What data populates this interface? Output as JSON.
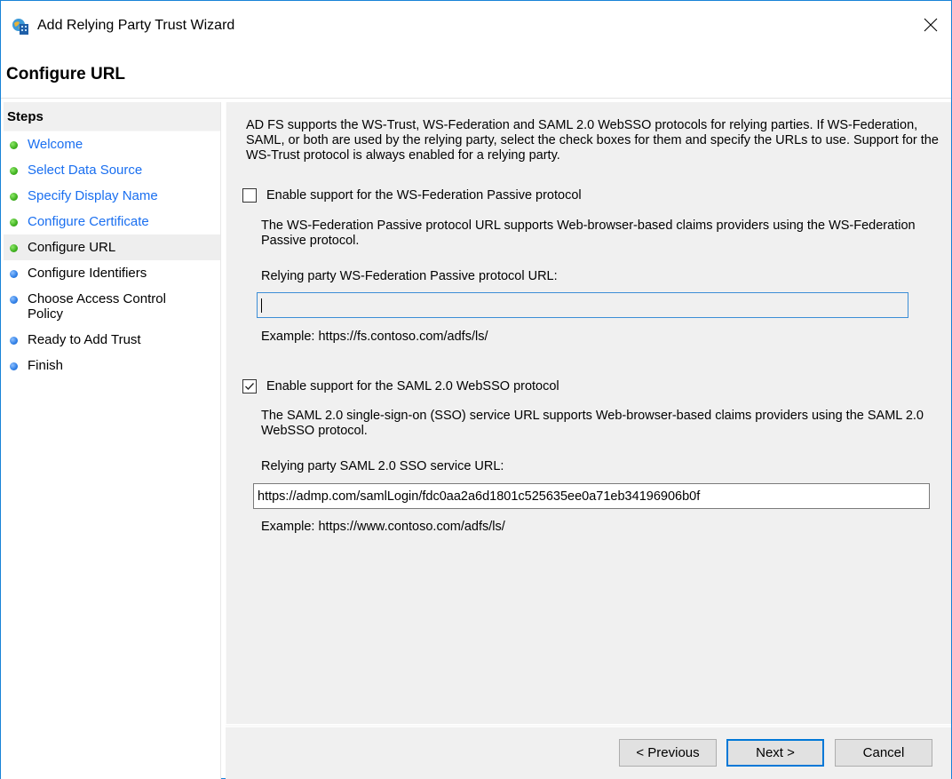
{
  "window": {
    "title": "Add Relying Party Trust Wizard",
    "icon": "adfs-trust-wizard-icon",
    "close_icon": "close-icon"
  },
  "header": {
    "title": "Configure URL"
  },
  "steps": {
    "heading": "Steps",
    "items": [
      {
        "label": "Welcome",
        "status": "completed",
        "link": true
      },
      {
        "label": "Select Data Source",
        "status": "completed",
        "link": true
      },
      {
        "label": "Specify Display Name",
        "status": "completed",
        "link": true
      },
      {
        "label": "Configure Certificate",
        "status": "completed",
        "link": true
      },
      {
        "label": "Configure URL",
        "status": "current",
        "link": false
      },
      {
        "label": "Configure Identifiers",
        "status": "pending",
        "link": false
      },
      {
        "label": "Choose Access Control Policy",
        "status": "pending",
        "link": false
      },
      {
        "label": "Ready to Add Trust",
        "status": "pending",
        "link": false
      },
      {
        "label": "Finish",
        "status": "pending",
        "link": false
      }
    ]
  },
  "content": {
    "intro": "AD FS supports the WS-Trust, WS-Federation and SAML 2.0 WebSSO protocols for relying parties.  If WS-Federation, SAML, or both are used by the relying party, select the check boxes for them and specify the URLs to use.  Support for the WS-Trust protocol is always enabled for a relying party.",
    "wsfed": {
      "checkbox_label": "Enable support for the WS-Federation Passive protocol",
      "checked": false,
      "description": "The WS-Federation Passive protocol URL supports Web-browser-based claims providers using the WS-Federation Passive protocol.",
      "field_label": "Relying party WS-Federation Passive protocol URL:",
      "value": "",
      "example": "Example: https://fs.contoso.com/adfs/ls/"
    },
    "saml": {
      "checkbox_label": "Enable support for the SAML 2.0 WebSSO protocol",
      "checked": true,
      "description": "The SAML 2.0 single-sign-on (SSO) service URL supports Web-browser-based claims providers using the SAML 2.0 WebSSO protocol.",
      "field_label": "Relying party SAML 2.0 SSO service URL:",
      "value": "https://admp.com/samlLogin/fdc0aa2a6d1801c525635ee0a71eb34196906b0f",
      "example": "Example: https://www.contoso.com/adfs/ls/"
    }
  },
  "footer": {
    "previous_label": "< Previous",
    "next_label": "Next >",
    "cancel_label": "Cancel"
  },
  "colors": {
    "accent": "#0078d7",
    "window_border": "#1883d7",
    "link": "#1a6ff0",
    "completed_dot": "#3fb11f",
    "pending_dot": "#2f7fe6"
  }
}
